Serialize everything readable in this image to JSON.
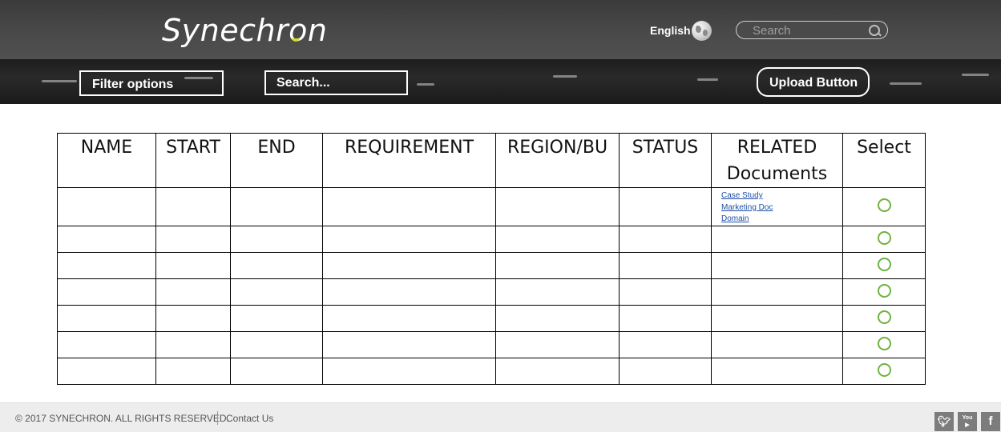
{
  "header": {
    "logo_text": "Synechron",
    "language": "English",
    "search_placeholder": "Search"
  },
  "toolbar": {
    "filter_label": "Filter options",
    "search_label": "Search...",
    "upload_label": "Upload Button"
  },
  "table": {
    "columns": [
      "NAME",
      "START",
      "END",
      "REQUIREMENT",
      "REGION/BU",
      "STATUS",
      "RELATED Documents",
      "Select"
    ],
    "related_documents": [
      "Case Study",
      "Marketing Doc",
      "Domain"
    ],
    "row_count": 7
  },
  "footer": {
    "copyright": "© 2017 SYNECHRON. ALL RIGHTS RESERVED.",
    "contact": "Contact Us",
    "social": [
      "twitter-icon",
      "youtube-icon",
      "facebook-icon"
    ]
  },
  "colors": {
    "header_bg": "#4a4a4a",
    "accent_yellow": "#d7df23",
    "radio_green": "#6db33f",
    "link_blue": "#1f4fa8"
  }
}
